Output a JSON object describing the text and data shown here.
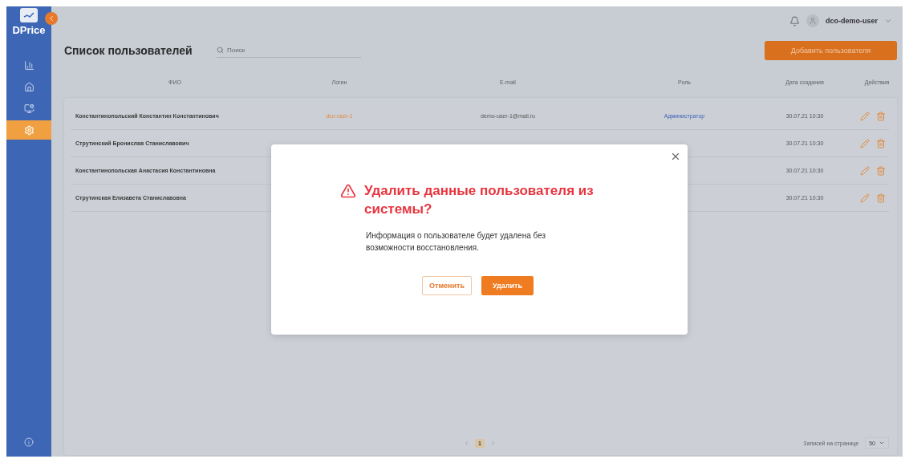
{
  "sidebar": {
    "logo": "DPrice",
    "items": [
      {
        "selected": false
      },
      {
        "selected": false
      },
      {
        "selected": false
      },
      {
        "selected": true
      }
    ]
  },
  "header": {
    "user": "dco-demo-user"
  },
  "page": {
    "title": "Список пользователей",
    "search": {
      "placeholder": "Поиск"
    },
    "add_button": "Добавить пользователя"
  },
  "table": {
    "columns": [
      "ФИО",
      "Логин",
      "E-mail",
      "Роль",
      "Дата создания",
      "Действия"
    ],
    "rows": [
      {
        "name": "Константинопольский Константин Константинович",
        "login": "dco-user-1",
        "email": "demo-user-1@mail.ru",
        "role": "Администратор",
        "date": "30.07.21 10:30"
      },
      {
        "name": "Струтинский Бронислав Станиславович",
        "date": "30.07.21 10:30"
      },
      {
        "name": "Константинопольская Анастасия Константиновна",
        "date": "30.07.21 10:30"
      },
      {
        "name": "Струтинская Елизавета Станиславовна",
        "date": "30.07.21 10:30"
      }
    ]
  },
  "pagination": {
    "pages": [
      {
        "label": "1",
        "selected": true
      }
    ],
    "per_page_label": "Записей на странице",
    "per_page": "50"
  },
  "dialog": {
    "title": "Удалить данные пользователя из системы?",
    "message": "Информация о пользователе будет удалена без возможности восстановления.",
    "cancel": "Отменить",
    "confirm": "Удалить"
  }
}
